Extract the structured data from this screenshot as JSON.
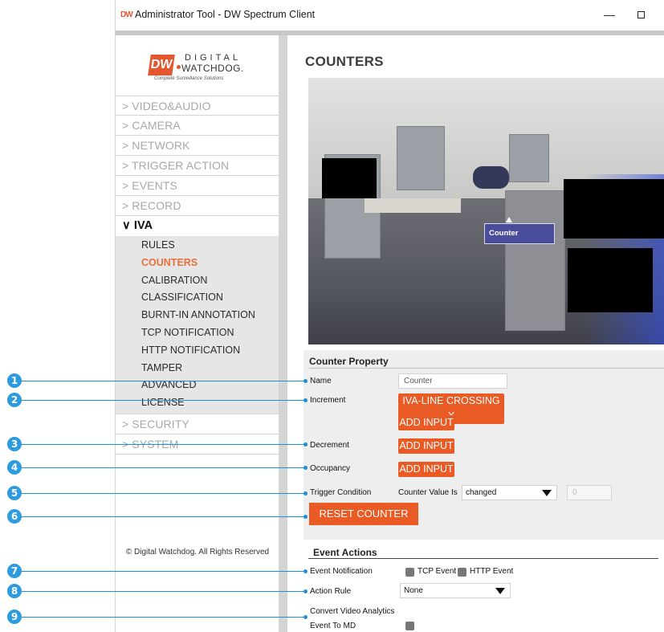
{
  "window": {
    "app_icon": "DW",
    "title": "Administrator Tool - DW Spectrum Client",
    "minimize_glyph": "—"
  },
  "logo": {
    "mark": "DW",
    "line1": "DIGITAL",
    "line2": "WATCHDOG.",
    "tagline": "Complete Surveillance Solutions"
  },
  "sidebar": {
    "items": [
      {
        "label": "> VIDEO&AUDIO"
      },
      {
        "label": "> CAMERA"
      },
      {
        "label": "> NETWORK"
      },
      {
        "label": "> TRIGGER ACTION"
      },
      {
        "label": "> EVENTS"
      },
      {
        "label": "> RECORD"
      }
    ],
    "open_item": {
      "label": "∨ IVA"
    },
    "sub_items": [
      {
        "label": "RULES"
      },
      {
        "label": "COUNTERS"
      },
      {
        "label": "CALIBRATION"
      },
      {
        "label": "CLASSIFICATION"
      },
      {
        "label": "BURNT-IN ANNOTATION"
      },
      {
        "label": "TCP NOTIFICATION"
      },
      {
        "label": "HTTP NOTIFICATION"
      },
      {
        "label": "TAMPER"
      },
      {
        "label": "ADVANCED"
      },
      {
        "label": "LICENSE"
      }
    ],
    "after_items": [
      {
        "label": "> SECURITY"
      },
      {
        "label": "> SYSTEM"
      }
    ],
    "copyright": "© Digital Watchdog. All Rights Reserved"
  },
  "main": {
    "page_title": "COUNTERS",
    "video_counter_label": "Counter",
    "counter_property": {
      "title": "Counter Property",
      "name_label": "Name",
      "name_value": "Counter",
      "increment_label": "Increment",
      "increment_chip": "IVA-LINE CROSSING X",
      "add_input_label": "ADD INPUT",
      "decrement_label": "Decrement",
      "occupancy_label": "Occupancy",
      "trigger_label": "Trigger Condition",
      "counter_value_is": "Counter Value Is",
      "trigger_select": "changed",
      "trigger_value": "0",
      "reset_button": "RESET COUNTER"
    },
    "event_actions": {
      "title": "Event Actions",
      "notification_label": "Event Notification",
      "tcp_event": "TCP Event",
      "http_event": "HTTP Event",
      "action_rule_label": "Action Rule",
      "action_rule_value": "None",
      "convert_label_1": "Convert Video Analytics",
      "convert_label_2": "Event To MD"
    }
  },
  "callouts": [
    "1",
    "2",
    "3",
    "4",
    "5",
    "6",
    "7",
    "8",
    "9"
  ],
  "colors": {
    "accent": "#ea5a24",
    "active_menu": "#e8703a",
    "callout": "#2d9be0"
  }
}
